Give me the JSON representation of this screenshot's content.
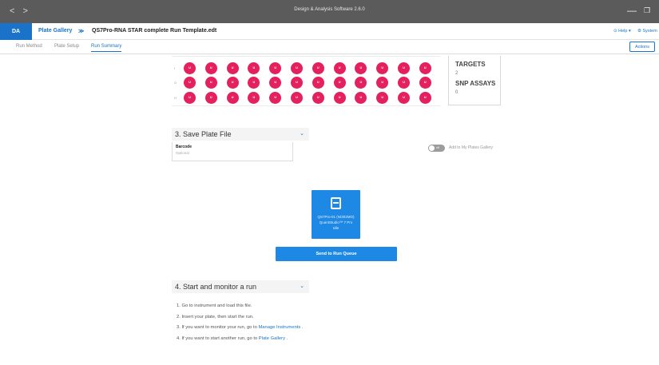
{
  "window": {
    "title": "Design & Analysis Software 2.6.0",
    "back_glyph": "<",
    "forward_glyph": ">",
    "minimize_glyph": "—",
    "restore_glyph": "❐"
  },
  "appbar": {
    "logo": "DA",
    "breadcrumb_link": "Plate Gallery",
    "breadcrumb_sep": "≫",
    "file_name": "QS7Pro-RNA STAR complete Run Template.edt",
    "help": "⊙ Help ▾",
    "system": "⚙ System"
  },
  "tabs": [
    {
      "label": "Run Method",
      "active": false
    },
    {
      "label": "Plate Setup",
      "active": false
    },
    {
      "label": "Run Summary",
      "active": true
    }
  ],
  "actions_label": "Actions",
  "plate": {
    "row_labels": [
      "I",
      "G",
      "H"
    ],
    "well_label": "U",
    "columns": 12,
    "well_color": "#e4205e"
  },
  "targets_panel": {
    "targets_heading": "TARGETS",
    "targets_value": "2",
    "snp_heading": "SNP ASSAYS",
    "snp_value": "0"
  },
  "save_section": {
    "heading": "3. Save Plate File",
    "chevron": "⌄",
    "barcode_label": "Barcode",
    "barcode_placeholder": "Optional",
    "toggle_state": "off",
    "toggle_label": "Add to My Plates Gallery"
  },
  "instrument_card": {
    "line1": "QS7Pro-01 (N/302MO)",
    "line2": "QuantStudio™ 7 Pro",
    "line3": "Idle"
  },
  "send_button": "Send to Run Queue",
  "monitor_section": {
    "heading": "4. Start and monitor a run",
    "chevron": "⌄",
    "steps": [
      {
        "text": "1. Go to instrument and load this file.",
        "link": ""
      },
      {
        "text": "2. Insert your plate, then start the run.",
        "link": ""
      },
      {
        "text": "3. If you want to monitor your run, go to ",
        "link": "Manage Instruments",
        "suffix": " ."
      },
      {
        "text": "4. If you want to start another run, go to ",
        "link": "Plate Gallery",
        "suffix": " ."
      }
    ]
  },
  "colors": {
    "accent": "#1a73c9",
    "button": "#1e88e5",
    "titlebar": "#5b5b5b"
  }
}
